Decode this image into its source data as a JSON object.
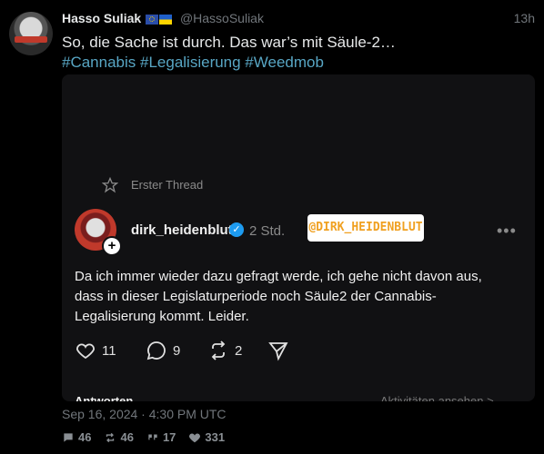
{
  "post": {
    "author_name": "Hasso Suliak",
    "author_handle": "@HassoSuliak",
    "time_ago": "13h",
    "text_line1": "So, die Sache ist durch. Das war’s mit Säule-2…",
    "hashtags": "#Cannabis #Legalisierung #Weedmob",
    "date": "Sep 16, 2024 · 4:30 PM UTC",
    "stats": {
      "replies": "46",
      "reposts": "46",
      "quotes": "17",
      "likes": "331"
    }
  },
  "embed": {
    "thread_label": "Erster Thread",
    "username": "dirk_heidenblut",
    "time_ago": "2 Std.",
    "sticker": "@DIRK_HEIDENBLUT",
    "body": "Da ich immer wieder dazu gefragt werde, ich gehe nicht davon aus, dass in dieser Legislaturperiode noch Säule2 der Cannabis-Legalisierung kommt. Leider.",
    "likes": "11",
    "comments": "9",
    "reposts": "2",
    "reply_label": "Antworten",
    "activity_label": "Aktivitäten ansehen >"
  },
  "colors": {
    "hashtag": "#58a6c4",
    "verified": "#1d9bf0",
    "sticker_text": "#f0a020"
  }
}
